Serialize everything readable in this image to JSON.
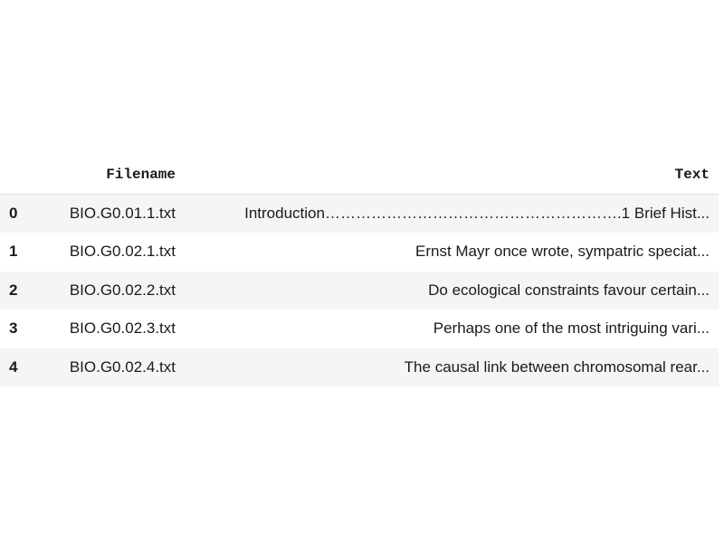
{
  "dataframe": {
    "columns": {
      "index": "",
      "filename": "Filename",
      "text": "Text"
    },
    "rows": [
      {
        "index": "0",
        "filename": "BIO.G0.01.1.txt",
        "text": "Introduction………………………………………………….1 Brief Hist..."
      },
      {
        "index": "1",
        "filename": "BIO.G0.02.1.txt",
        "text": "Ernst Mayr once wrote, sympatric speciat..."
      },
      {
        "index": "2",
        "filename": "BIO.G0.02.2.txt",
        "text": "Do ecological constraints favour certain..."
      },
      {
        "index": "3",
        "filename": "BIO.G0.02.3.txt",
        "text": "Perhaps one of the most intriguing vari..."
      },
      {
        "index": "4",
        "filename": "BIO.G0.02.4.txt",
        "text": "The causal link between chromosomal rear..."
      }
    ]
  }
}
